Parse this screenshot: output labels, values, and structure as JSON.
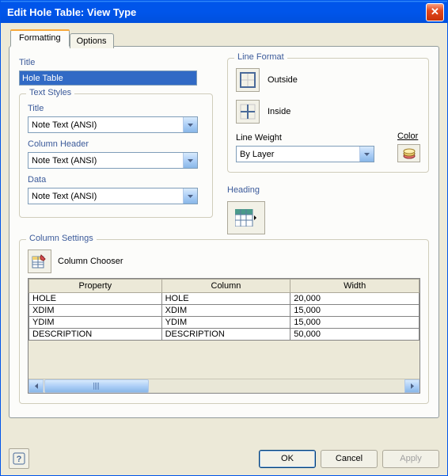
{
  "window": {
    "title": "Edit Hole Table: View Type"
  },
  "tabs": {
    "formatting": "Formatting",
    "options": "Options"
  },
  "title_section": {
    "label": "Title",
    "value": "Hole Table"
  },
  "text_styles": {
    "group": "Text Styles",
    "title_label": "Title",
    "title_value": "Note Text (ANSI)",
    "header_label": "Column Header",
    "header_value": "Note Text (ANSI)",
    "data_label": "Data",
    "data_value": "Note Text (ANSI)"
  },
  "line_format": {
    "group": "Line Format",
    "outside": "Outside",
    "inside": "Inside",
    "weight_label": "Line Weight",
    "weight_value": "By Layer",
    "color_label": "Color"
  },
  "heading": {
    "label": "Heading"
  },
  "column_settings": {
    "group": "Column Settings",
    "chooser": "Column Chooser",
    "headers": {
      "property": "Property",
      "column": "Column",
      "width": "Width"
    },
    "rows": [
      {
        "property": "HOLE",
        "column": "HOLE",
        "width": "20,000"
      },
      {
        "property": "XDIM",
        "column": "XDIM",
        "width": "15,000"
      },
      {
        "property": "YDIM",
        "column": "YDIM",
        "width": "15,000"
      },
      {
        "property": "DESCRIPTION",
        "column": "DESCRIPTION",
        "width": "50,000"
      }
    ]
  },
  "buttons": {
    "ok": "OK",
    "cancel": "Cancel",
    "apply": "Apply"
  },
  "icons": {
    "help": "?",
    "close": "X"
  }
}
